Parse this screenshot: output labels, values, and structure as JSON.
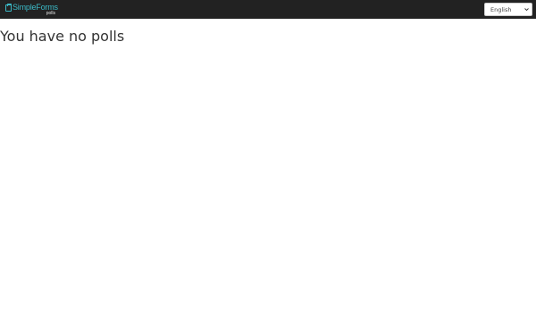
{
  "header": {
    "logo": {
      "name": "SimpleForms",
      "subtitle": "polls"
    },
    "language_select": {
      "selected": "English",
      "icon": "chevron-down-icon"
    }
  },
  "main": {
    "empty_message": "You have no polls"
  },
  "colors": {
    "topbar_bg": "#222222",
    "brand_teal": "#3bb9c6",
    "text": "#333333"
  }
}
